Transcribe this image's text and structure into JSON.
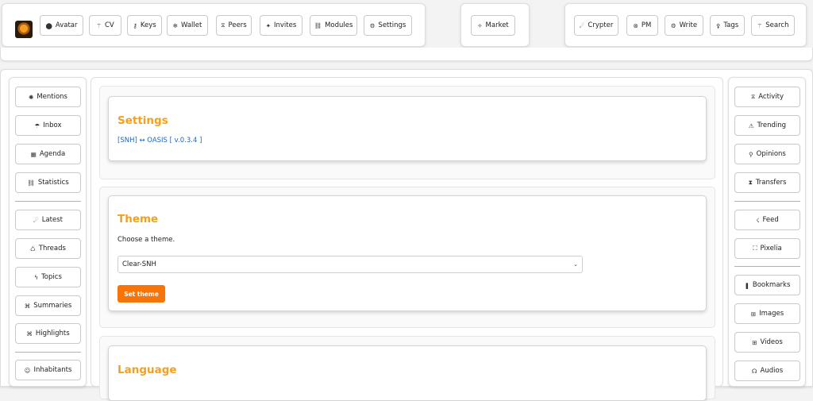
{
  "topnav": {
    "left": [
      {
        "label": "Avatar",
        "icon": "⬤"
      },
      {
        "label": "CV",
        "icon": "⚚"
      },
      {
        "label": "Keys",
        "icon": "⚷"
      },
      {
        "label": "Wallet",
        "icon": "❄"
      },
      {
        "label": "Peers",
        "icon": "⧖"
      },
      {
        "label": "Invites",
        "icon": "✦"
      },
      {
        "label": "Modules",
        "icon": "⛓"
      },
      {
        "label": "Settings",
        "icon": "⚙"
      }
    ],
    "middle": [
      {
        "label": "Market",
        "icon": "✧"
      }
    ],
    "right": [
      {
        "label": "Crypter",
        "icon": "☄"
      },
      {
        "label": "PM",
        "icon": "⊗"
      },
      {
        "label": "Write",
        "icon": "⚙"
      },
      {
        "label": "Tags",
        "icon": "⚴"
      },
      {
        "label": "Search",
        "icon": "⚚"
      }
    ]
  },
  "leftnav": [
    [
      {
        "label": "Mentions",
        "icon": "✺"
      },
      {
        "label": "Inbox",
        "icon": "☂"
      },
      {
        "label": "Agenda",
        "icon": "▦"
      },
      {
        "label": "Statistics",
        "icon": "⛓"
      }
    ],
    [
      {
        "label": "Latest",
        "icon": "☄"
      },
      {
        "label": "Threads",
        "icon": "♺"
      },
      {
        "label": "Topics",
        "icon": "ϟ"
      },
      {
        "label": "Summaries",
        "icon": "⌘"
      },
      {
        "label": "Highlights",
        "icon": "⌘"
      }
    ],
    [
      {
        "label": "Inhabitants",
        "icon": "☺"
      }
    ]
  ],
  "rightnav": [
    [
      {
        "label": "Activity",
        "icon": "⧖"
      },
      {
        "label": "Trending",
        "icon": "⚠"
      },
      {
        "label": "Opinions",
        "icon": "⚲"
      },
      {
        "label": "Transfers",
        "icon": "⧗"
      }
    ],
    [
      {
        "label": "Feed",
        "icon": "☇"
      },
      {
        "label": "Pixelia",
        "icon": "⛶"
      }
    ],
    [
      {
        "label": "Bookmarks",
        "icon": "❚"
      },
      {
        "label": "Images",
        "icon": "⊞"
      },
      {
        "label": "Videos",
        "icon": "⊞"
      },
      {
        "label": "Audios",
        "icon": "☊"
      }
    ]
  ],
  "settings": {
    "title": "Settings",
    "version_link": "[SNH] ↔ OASIS [ v.0.3.4 ]"
  },
  "theme": {
    "title": "Theme",
    "description": "Choose a theme.",
    "selected": "Clear-SNH",
    "button": "Set theme"
  },
  "language": {
    "title": "Language"
  },
  "colors": {
    "accent": "#f5a01a",
    "button": "#f87408",
    "link": "#1a66c6",
    "separator": "#f1a64a"
  }
}
